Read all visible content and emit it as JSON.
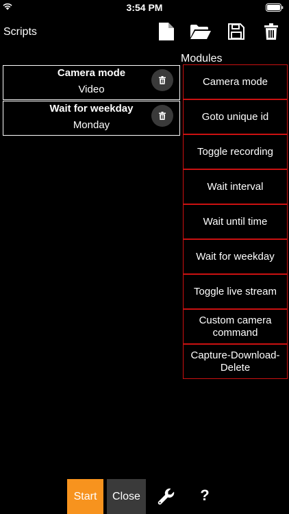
{
  "status_bar": {
    "time": "3:54 PM",
    "icons": [
      "wifi-icon",
      "battery-icon"
    ]
  },
  "header": {
    "title": "Scripts",
    "toolbar_icons": [
      "new-file-icon",
      "open-folder-icon",
      "save-icon",
      "trash-icon"
    ]
  },
  "script": {
    "items": [
      {
        "title": "Camera mode",
        "value": "Video"
      },
      {
        "title": "Wait for weekday",
        "value": "Monday"
      }
    ]
  },
  "modules": {
    "title": "Modules",
    "items": [
      {
        "label": "Camera mode"
      },
      {
        "label": "Goto unique id"
      },
      {
        "label": "Toggle recording"
      },
      {
        "label": "Wait interval"
      },
      {
        "label": "Wait until time"
      },
      {
        "label": "Wait for weekday"
      },
      {
        "label": "Toggle live stream"
      },
      {
        "label": "Custom camera command"
      },
      {
        "label": "Capture-Download-Delete"
      }
    ]
  },
  "footer": {
    "start_label": "Start",
    "close_label": "Close",
    "help_label": "?",
    "icons": [
      "wrench-icon"
    ]
  },
  "colors": {
    "background": "#000000",
    "module_border": "#cc1111",
    "start_button": "#f7931e",
    "close_button": "#3a3a3a"
  }
}
